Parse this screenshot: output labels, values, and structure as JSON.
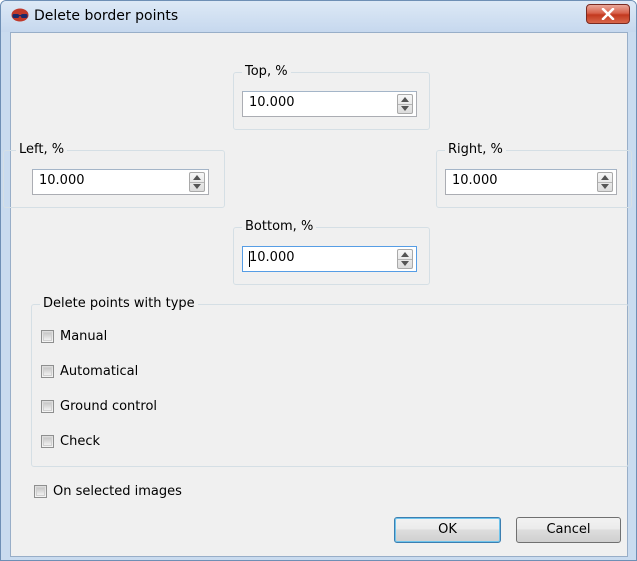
{
  "window": {
    "title": "Delete border points",
    "app_icon": "anaglyph-glasses-icon",
    "close_icon": "close-icon"
  },
  "margins": {
    "top": {
      "label": "Top, %",
      "value": "10.000"
    },
    "left": {
      "label": "Left, %",
      "value": "10.000"
    },
    "right": {
      "label": "Right, %",
      "value": "10.000"
    },
    "bottom": {
      "label": "Bottom, %",
      "value": "10.000"
    }
  },
  "point_types": {
    "title": "Delete points with type",
    "items": [
      {
        "label": "Manual",
        "checked": false
      },
      {
        "label": "Automatical",
        "checked": false
      },
      {
        "label": "Ground control",
        "checked": false
      },
      {
        "label": "Check",
        "checked": false
      }
    ]
  },
  "selected_images": {
    "label": "On selected images",
    "checked": false
  },
  "buttons": {
    "ok": "OK",
    "cancel": "Cancel"
  },
  "colors": {
    "close_button": "#c3391f",
    "focus_border": "#569de5",
    "default_button_border": "#3c7fb1"
  }
}
